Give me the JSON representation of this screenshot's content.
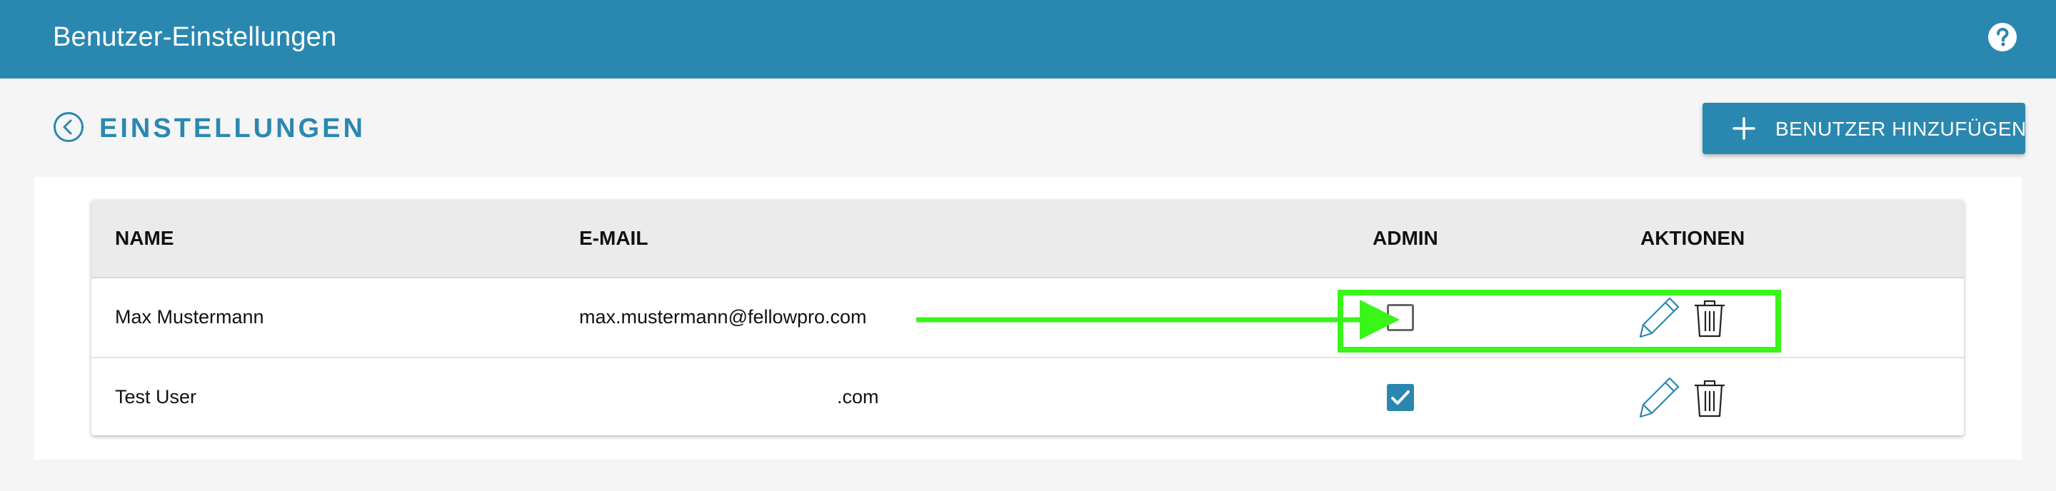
{
  "app": {
    "window_title": "Benutzer-Einstellungen",
    "help_icon": "help-circle-icon"
  },
  "page": {
    "title": "EINSTELLUNGEN",
    "back_icon": "back-circle-icon",
    "add_user_label": "BENUTZER HINZUFÜGEN",
    "add_user_icon": "plus-icon"
  },
  "table": {
    "columns": {
      "name": "NAME",
      "email": "E-MAIL",
      "admin": "ADMIN",
      "actions": "AKTIONEN"
    },
    "rows": [
      {
        "name": "Max Mustermann",
        "email": "max.mustermann@fellowpro.com",
        "admin": false
      },
      {
        "name": "Test User",
        "email": ".com",
        "admin": true
      }
    ]
  },
  "colors": {
    "primary": "#2a88b0",
    "annotation": "#39f51a",
    "page_background": "#f5f5f5",
    "header_background": "#ebebeb"
  }
}
